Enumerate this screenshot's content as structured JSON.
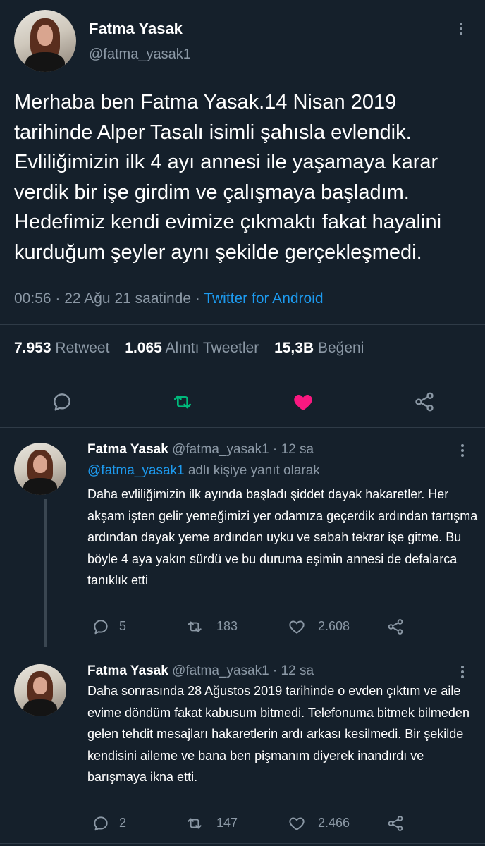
{
  "main_tweet": {
    "name": "Fatma Yasak",
    "handle": "@fatma_yasak1",
    "text": "Merhaba ben Fatma Yasak.14 Nisan 2019 tarihinde Alper Tasalı isimli şahısla evlendik. Evliliğimizin ilk 4 ayı annesi ile yaşamaya karar verdik bir işe girdim ve çalışmaya başladım. Hedefimiz kendi evimize çıkmaktı fakat hayalini kurduğum şeyler aynı şekilde gerçekleşmedi.",
    "time": "00:56 · 22 Ağu 21 saatinde · ",
    "source": "Twitter for Android",
    "stats": {
      "retweets_count": "7.953",
      "retweets_label": "Retweet",
      "quotes_count": "1.065",
      "quotes_label": "Alıntı Tweetler",
      "likes_count": "15,3B",
      "likes_label": "Beğeni"
    }
  },
  "replies": [
    {
      "name": "Fatma Yasak",
      "handle": "@fatma_yasak1",
      "time": " · 12 sa",
      "reply_to_handle": "@fatma_yasak1",
      "reply_to_suffix": " adlı kişiye yanıt olarak",
      "text": "Daha evliliğimizin ilk ayında başladı şiddet dayak hakaretler. Her akşam işten gelir yemeğimizi yer odamıza geçerdik ardından tartışma ardından dayak yeme ardından uyku ve sabah tekrar işe gitme. Bu böyle 4 aya yakın sürdü ve bu duruma eşimin annesi de defalarca tanıklık etti",
      "replies": "5",
      "retweets": "183",
      "likes": "2.608"
    },
    {
      "name": "Fatma Yasak",
      "handle": "@fatma_yasak1",
      "time": " · 12 sa",
      "text": "Daha sonrasında 28 Ağustos 2019 tarihinde o evden çıktım ve aile evime döndüm fakat kabusum bitmedi. Telefonuma bitmek bilmeden gelen tehdit mesajları hakaretlerin ardı arkası kesilmedi. Bir şekilde kendisini aileme ve bana ben pişmanım diyerek inandırdı ve barışmaya ikna etti.",
      "replies": "2",
      "retweets": "147",
      "likes": "2.466"
    }
  ],
  "icons": {
    "reply": "speech-bubble-icon",
    "retweet": "retweet-arrows-icon",
    "like": "heart-icon",
    "share": "share-icon",
    "more": "more-vertical-icon"
  },
  "colors": {
    "background": "#15202b",
    "text": "#ffffff",
    "muted": "#8b98a5",
    "link": "#1d9bf0",
    "retweet_active": "#00ba7c",
    "like_active": "#f91880"
  }
}
